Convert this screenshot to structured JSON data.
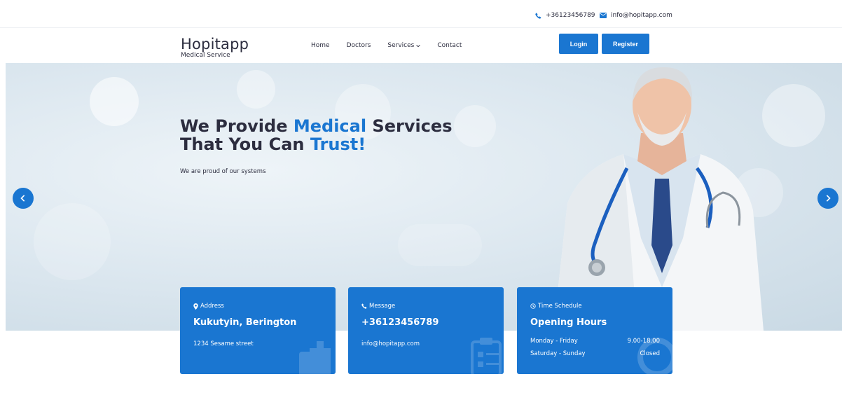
{
  "topbar": {
    "phone": "+36123456789",
    "email": "info@hopitapp.com",
    "phone_icon": "phone-icon",
    "email_icon": "envelope-icon"
  },
  "brand": {
    "name": "Hopitapp",
    "tagline": "Medical Service"
  },
  "nav": {
    "items": [
      "Home",
      "Doctors",
      "Services",
      "Contact"
    ],
    "login_label": "Login",
    "register_label": "Register"
  },
  "hero": {
    "title_line1_prefix": "We Provide ",
    "title_line1_accent": "Medical",
    "title_line1_suffix": " Services",
    "title_line2_prefix": "That You Can ",
    "title_line2_accent": "Trust!",
    "subtitle": "We are proud of our systems"
  },
  "cards": [
    {
      "kicker": "Address",
      "icon": "map-marker-icon",
      "heading": "Kukutyin, Berington",
      "body": "1234 Sesame street"
    },
    {
      "kicker": "Message",
      "icon": "phone-icon",
      "heading": "+36123456789",
      "body": "info@hopitapp.com"
    },
    {
      "kicker": "Time Schedule",
      "icon": "clock-icon",
      "heading": "Opening Hours",
      "rows": [
        {
          "label": "Monday - Friday",
          "value": "9.00-18.00"
        },
        {
          "label": "Saturday - Sunday",
          "value": "Closed"
        }
      ]
    }
  ],
  "colors": {
    "accent": "#1a76d1",
    "text": "#2c2d3f"
  }
}
